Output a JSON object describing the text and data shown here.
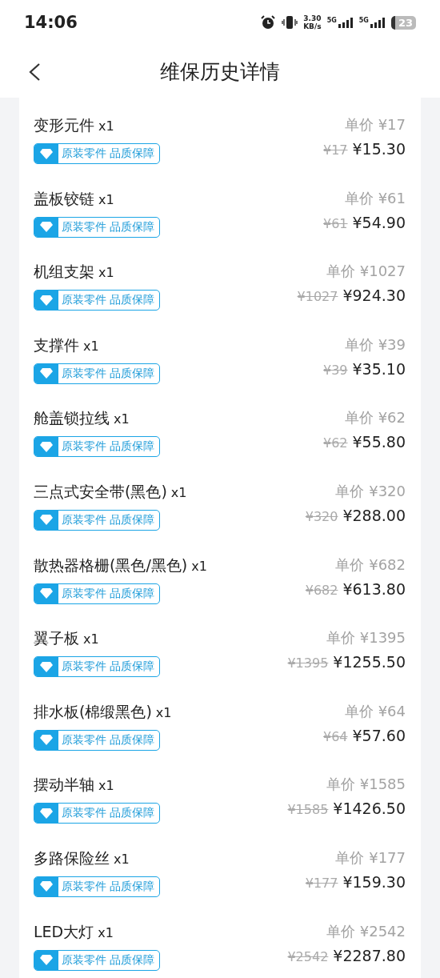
{
  "status_bar": {
    "time": "14:06",
    "speed_value": "3.30",
    "speed_unit": "KB/s",
    "networks": [
      "5G",
      "5G"
    ],
    "battery": "23"
  },
  "header": {
    "title": "维保历史详情"
  },
  "parts": [
    {
      "name": "变形元件",
      "qty": "x1",
      "unit_price": "单价 ¥17",
      "original_price": "¥17",
      "price": "¥15.30",
      "badge": "原装零件 品质保障"
    },
    {
      "name": "盖板铰链",
      "qty": "x1",
      "unit_price": "单价 ¥61",
      "original_price": "¥61",
      "price": "¥54.90",
      "badge": "原装零件 品质保障"
    },
    {
      "name": "机组支架",
      "qty": "x1",
      "unit_price": "单价 ¥1027",
      "original_price": "¥1027",
      "price": "¥924.30",
      "badge": "原装零件 品质保障"
    },
    {
      "name": "支撑件",
      "qty": "x1",
      "unit_price": "单价 ¥39",
      "original_price": "¥39",
      "price": "¥35.10",
      "badge": "原装零件 品质保障"
    },
    {
      "name": "舱盖锁拉线",
      "qty": "x1",
      "unit_price": "单价 ¥62",
      "original_price": "¥62",
      "price": "¥55.80",
      "badge": "原装零件 品质保障"
    },
    {
      "name": "三点式安全带(黑色)",
      "qty": "x1",
      "unit_price": "单价 ¥320",
      "original_price": "¥320",
      "price": "¥288.00",
      "badge": "原装零件 品质保障"
    },
    {
      "name": "散热器格栅(黑色/黑色)",
      "qty": "x1",
      "unit_price": "单价 ¥682",
      "original_price": "¥682",
      "price": "¥613.80",
      "badge": "原装零件 品质保障"
    },
    {
      "name": "翼子板",
      "qty": "x1",
      "unit_price": "单价 ¥1395",
      "original_price": "¥1395",
      "price": "¥1255.50",
      "badge": "原装零件 品质保障"
    },
    {
      "name": "排水板(棉缎黑色)",
      "qty": "x1",
      "unit_price": "单价 ¥64",
      "original_price": "¥64",
      "price": "¥57.60",
      "badge": "原装零件 品质保障"
    },
    {
      "name": "摆动半轴",
      "qty": "x1",
      "unit_price": "单价 ¥1585",
      "original_price": "¥1585",
      "price": "¥1426.50",
      "badge": "原装零件 品质保障"
    },
    {
      "name": "多路保险丝",
      "qty": "x1",
      "unit_price": "单价 ¥177",
      "original_price": "¥177",
      "price": "¥159.30",
      "badge": "原装零件 品质保障"
    },
    {
      "name": "LED大灯",
      "qty": "x1",
      "unit_price": "单价 ¥2542",
      "original_price": "¥2542",
      "price": "¥2287.80",
      "badge": "原装零件 品质保障"
    }
  ]
}
